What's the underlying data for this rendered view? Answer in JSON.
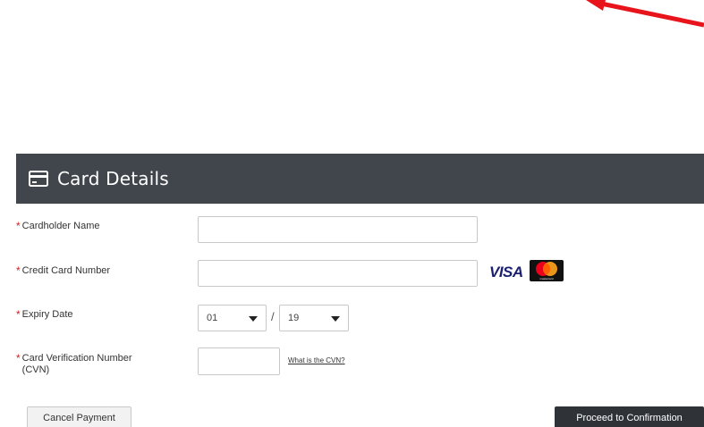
{
  "header": {
    "title": "Card Details",
    "icon": "credit-card-icon"
  },
  "fields": {
    "cardholder_name": {
      "label": "Cardholder Name",
      "value": "",
      "required_mark": "*"
    },
    "card_number": {
      "label": "Credit Card Number",
      "value": "",
      "required_mark": "*"
    },
    "expiry": {
      "label": "Expiry Date",
      "month": "01",
      "year": "19",
      "separator": "/",
      "required_mark": "*"
    },
    "cvn": {
      "label_line1": "Card Verification Number",
      "label_line2": "(CVN)",
      "value": "",
      "help_link": "What is the CVN?",
      "required_mark": "*"
    }
  },
  "brands": {
    "visa": "VISA",
    "mastercard": "mastercard"
  },
  "buttons": {
    "cancel": "Cancel Payment",
    "proceed": "Proceed to Confirmation"
  },
  "colors": {
    "header_bg": "#41464d",
    "required": "#d61f1f",
    "proceed_bg": "#2f3338",
    "annotation_arrow": "#e8141b"
  }
}
